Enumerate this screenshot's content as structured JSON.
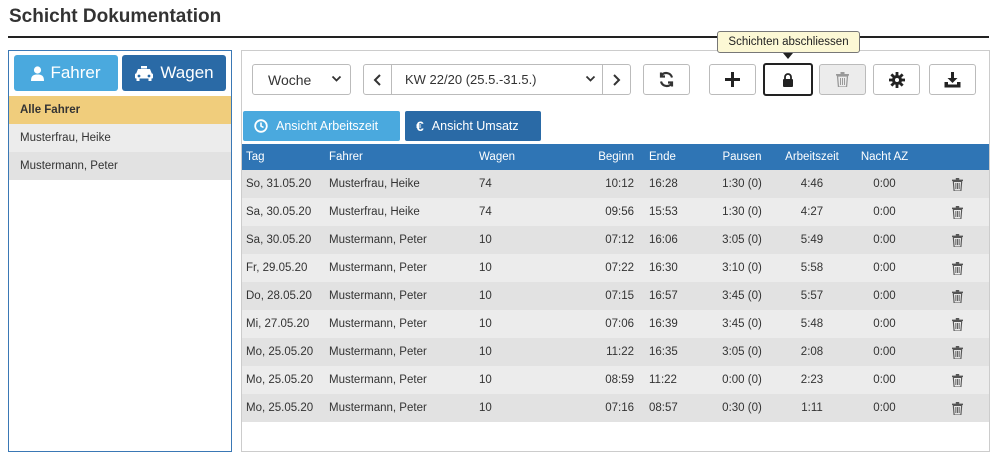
{
  "page": {
    "title": "Schicht Dokumentation"
  },
  "sidebar": {
    "toggle_fahrer": "Fahrer",
    "toggle_wagen": "Wagen",
    "items": [
      {
        "label": "Alle Fahrer"
      },
      {
        "label": "Musterfrau, Heike"
      },
      {
        "label": "Mustermann, Peter"
      }
    ]
  },
  "toolbar": {
    "period": "Woche",
    "week": "KW 22/20 (25.5.-31.5.)",
    "tooltip": "Schichten abschliessen"
  },
  "views": {
    "arbeitszeit": "Ansicht Arbeitszeit",
    "umsatz": "Ansicht Umsatz"
  },
  "table": {
    "headers": [
      "Tag",
      "Fahrer",
      "Wagen",
      "Beginn",
      "Ende",
      "Pausen",
      "Arbeitszeit",
      "Nacht AZ"
    ],
    "rows": [
      {
        "tag": "So, 31.05.20",
        "fahrer": "Musterfrau, Heike",
        "wagen": "74",
        "beginn": "10:12",
        "ende": "16:28",
        "pausen": "1:30 (0)",
        "az": "4:46",
        "nacht": "0:00"
      },
      {
        "tag": "Sa, 30.05.20",
        "fahrer": "Musterfrau, Heike",
        "wagen": "74",
        "beginn": "09:56",
        "ende": "15:53",
        "pausen": "1:30 (0)",
        "az": "4:27",
        "nacht": "0:00"
      },
      {
        "tag": "Sa, 30.05.20",
        "fahrer": "Mustermann, Peter",
        "wagen": "10",
        "beginn": "07:12",
        "ende": "16:06",
        "pausen": "3:05 (0)",
        "az": "5:49",
        "nacht": "0:00"
      },
      {
        "tag": "Fr, 29.05.20",
        "fahrer": "Mustermann, Peter",
        "wagen": "10",
        "beginn": "07:22",
        "ende": "16:30",
        "pausen": "3:10 (0)",
        "az": "5:58",
        "nacht": "0:00"
      },
      {
        "tag": "Do, 28.05.20",
        "fahrer": "Mustermann, Peter",
        "wagen": "10",
        "beginn": "07:15",
        "ende": "16:57",
        "pausen": "3:45 (0)",
        "az": "5:57",
        "nacht": "0:00"
      },
      {
        "tag": "Mi, 27.05.20",
        "fahrer": "Mustermann, Peter",
        "wagen": "10",
        "beginn": "07:06",
        "ende": "16:39",
        "pausen": "3:45 (0)",
        "az": "5:48",
        "nacht": "0:00"
      },
      {
        "tag": "Mo, 25.05.20",
        "fahrer": "Mustermann, Peter",
        "wagen": "10",
        "beginn": "11:22",
        "ende": "16:35",
        "pausen": "3:05 (0)",
        "az": "2:08",
        "nacht": "0:00"
      },
      {
        "tag": "Mo, 25.05.20",
        "fahrer": "Mustermann, Peter",
        "wagen": "10",
        "beginn": "08:59",
        "ende": "11:22",
        "pausen": "0:00 (0)",
        "az": "2:23",
        "nacht": "0:00"
      },
      {
        "tag": "Mo, 25.05.20",
        "fahrer": "Mustermann, Peter",
        "wagen": "10",
        "beginn": "07:16",
        "ende": "08:57",
        "pausen": "0:30 (0)",
        "az": "1:11",
        "nacht": "0:00"
      }
    ]
  }
}
